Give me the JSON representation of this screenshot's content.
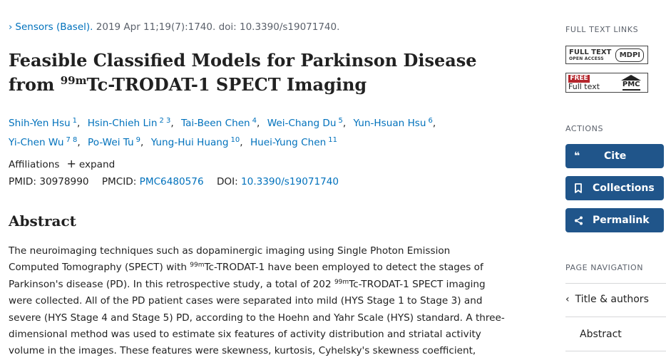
{
  "citation": {
    "chevron": "›",
    "journal": "Sensors (Basel).",
    "details": " 2019 Apr 11;19(7):1740. doi: 10.3390/s19071740."
  },
  "title": {
    "line1": "Feasible Classified Models for Parkinson Disease",
    "line2_pre": "from ",
    "line2_sup": "99m",
    "line2_post": "Tc-TRODAT-1 SPECT Imaging"
  },
  "authors": [
    {
      "name": "Shih-Yen Hsu",
      "sup": "1"
    },
    {
      "name": "Hsin-Chieh Lin",
      "sup": "2 3"
    },
    {
      "name": "Tai-Been Chen",
      "sup": "4"
    },
    {
      "name": "Wei-Chang Du",
      "sup": "5"
    },
    {
      "name": "Yun-Hsuan Hsu",
      "sup": "6"
    },
    {
      "name": "Yi-Chen Wu",
      "sup": "7 8"
    },
    {
      "name": "Po-Wei Tu",
      "sup": "9"
    },
    {
      "name": "Yung-Hui Huang",
      "sup": "10"
    },
    {
      "name": "Huei-Yung Chen",
      "sup": "11"
    }
  ],
  "affiliations": {
    "label": "Affiliations",
    "expand_icon": "+",
    "expand": "expand"
  },
  "ids": {
    "pmid_label": "PMID: ",
    "pmid": "30978990",
    "pmcid_label": "PMCID: ",
    "pmcid": "PMC6480576",
    "doi_label": "DOI: ",
    "doi": "10.3390/s19071740"
  },
  "abstract": {
    "heading": "Abstract",
    "l1": "The neuroimaging techniques such as dopaminergic imaging using Single Photon Emission",
    "l2_pre": "Computed Tomography (SPECT) with ",
    "l2_sup": "99m",
    "l2_post": "Tc-TRODAT-1 have been employed to detect the stages of",
    "l3_pre": "Parkinson's disease (PD). In this retrospective study, a total of 202 ",
    "l3_sup": "99m",
    "l3_post": "Tc-TRODAT-1 SPECT imaging",
    "l4": "were collected. All of the PD patient cases were separated into mild (HYS Stage 1 to Stage 3) and",
    "l5": "severe (HYS Stage 4 and Stage 5) PD, according to the Hoehn and Yahr Scale (HYS) standard. A three-",
    "l6": "dimensional method was used to estimate six features of activity distribution and striatal activity",
    "l7": "volume in the images. These features were skewness, kurtosis, Cyhelsky's skewness coefficient,"
  },
  "sidebar": {
    "full_text_links_label": "FULL TEXT LINKS",
    "mdpi": {
      "line1": "FULL TEXT",
      "line2": "OPEN ACCESS",
      "logo": "MDPI"
    },
    "pmc": {
      "free": "FREE",
      "full": "Full text",
      "logo": "PMC"
    },
    "actions_label": "ACTIONS",
    "cite": {
      "icon": "❝",
      "label": "Cite"
    },
    "collections": {
      "label": "Collections"
    },
    "permalink": {
      "label": "Permalink"
    },
    "page_nav_label": "PAGE NAVIGATION",
    "nav_title": {
      "chevron": "‹",
      "label": "Title & authors"
    },
    "nav_abstract": {
      "label": "Abstract"
    }
  },
  "colors": {
    "link": "#0071bc",
    "button": "#20558a",
    "text": "#212121",
    "muted": "#5b616b"
  }
}
